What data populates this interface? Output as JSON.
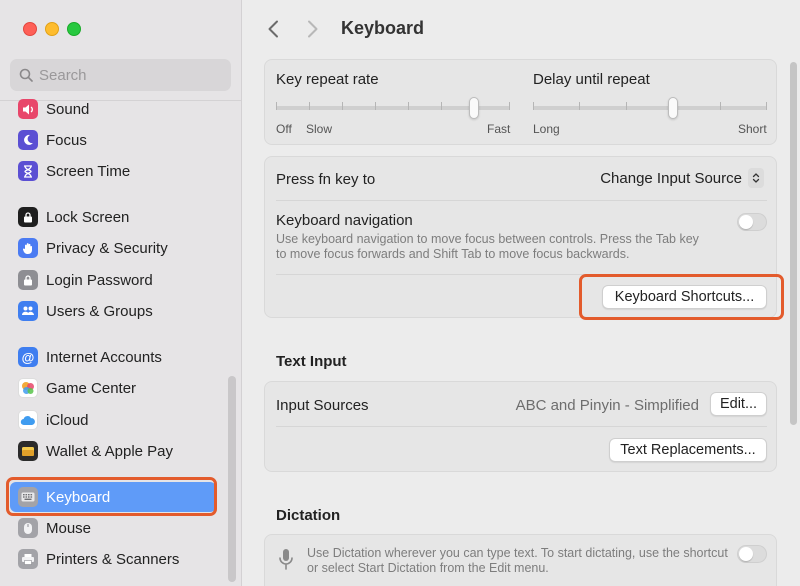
{
  "window": {
    "traffic_lights": [
      "close",
      "minimize",
      "zoom"
    ]
  },
  "sidebar": {
    "search": {
      "placeholder": "Search"
    },
    "items": [
      {
        "label": "Sound",
        "icon": "speaker-icon",
        "color": "#e8466a"
      },
      {
        "label": "Focus",
        "icon": "moon-icon",
        "color": "#5b4fd3"
      },
      {
        "label": "Screen Time",
        "icon": "hourglass-icon",
        "color": "#5b4fd3"
      },
      {
        "label": "Lock Screen",
        "icon": "lock-icon",
        "color": "#1f1f1f"
      },
      {
        "label": "Privacy & Security",
        "icon": "hand-icon",
        "color": "#4b7bf2"
      },
      {
        "label": "Login Password",
        "icon": "padlock-icon",
        "color": "#8e8e93"
      },
      {
        "label": "Users & Groups",
        "icon": "users-icon",
        "color": "#3f7ef0"
      },
      {
        "label": "Internet Accounts",
        "icon": "at-icon",
        "color": "#3f7ef0"
      },
      {
        "label": "Game Center",
        "icon": "game-center-icon",
        "color": "#f2a93b"
      },
      {
        "label": "iCloud",
        "icon": "cloud-icon",
        "color": "#3f9cf0"
      },
      {
        "label": "Wallet & Apple Pay",
        "icon": "wallet-icon",
        "color": "#2b2b2b"
      },
      {
        "label": "Keyboard",
        "icon": "keyboard-icon",
        "color": "#8e8e93",
        "selected": true
      },
      {
        "label": "Mouse",
        "icon": "mouse-icon",
        "color": "#8e8e93"
      },
      {
        "label": "Printers & Scanners",
        "icon": "printer-icon",
        "color": "#8e8e93"
      }
    ]
  },
  "toolbar": {
    "title": "Keyboard",
    "back_icon": "chevron-left-icon",
    "forward_icon": "chevron-right-icon"
  },
  "repeat": {
    "key_repeat_label": "Key repeat rate",
    "key_repeat_ticks": [
      "Off",
      "Slow",
      "Fast"
    ],
    "key_repeat_value": 0.85,
    "delay_label": "Delay until repeat",
    "delay_ticks": [
      "Long",
      "Short"
    ],
    "delay_value": 0.6
  },
  "settings": {
    "fn_label": "Press fn key to",
    "fn_value": "Change Input Source",
    "nav_label": "Keyboard navigation",
    "nav_desc_1": "Use keyboard navigation to move focus between controls. Press the Tab key",
    "nav_desc_2": "to move focus forwards and Shift Tab to move focus backwards.",
    "nav_enabled": false,
    "shortcuts_button": "Keyboard Shortcuts..."
  },
  "text_input": {
    "section_title": "Text Input",
    "sources_label": "Input Sources",
    "sources_value": "ABC and Pinyin - Simplified",
    "edit_button": "Edit...",
    "replacements_button": "Text Replacements..."
  },
  "dictation": {
    "section_title": "Dictation",
    "desc_1": "Use Dictation wherever you can type text. To start dictating, use the shortcut",
    "desc_2": "or select Start Dictation from the Edit menu.",
    "enabled": false
  },
  "colors": {
    "accent": "#5f9bf8",
    "highlight": "#e35b2c"
  }
}
